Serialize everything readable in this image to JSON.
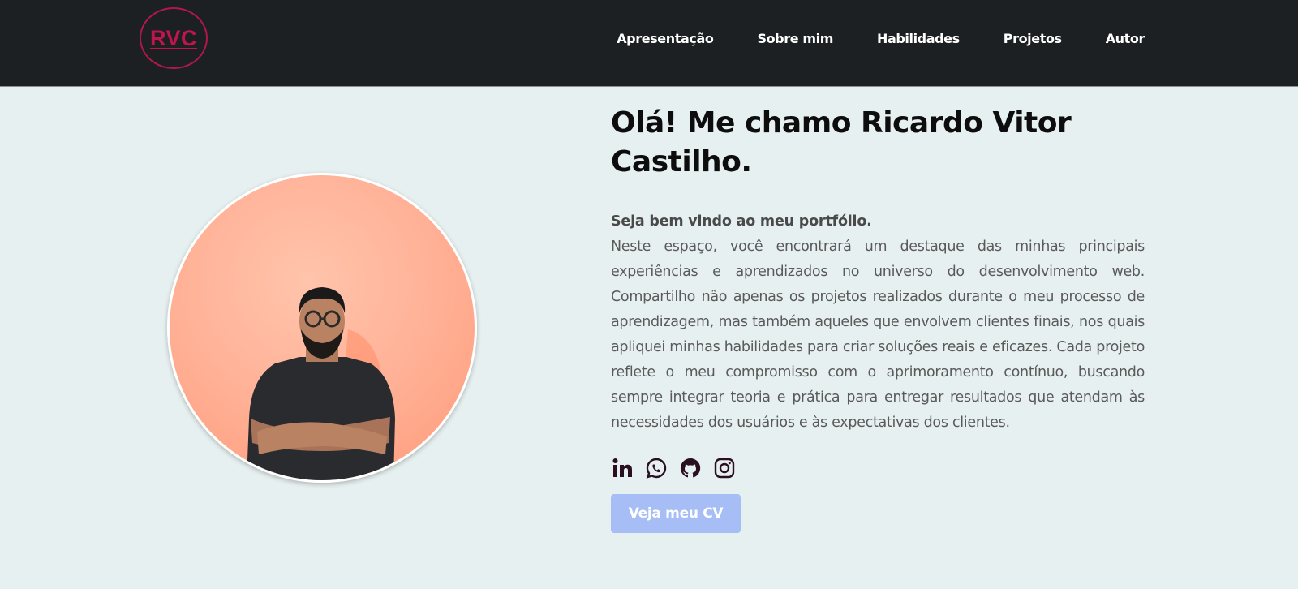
{
  "header": {
    "logo_text": "RVC",
    "nav": [
      {
        "label": "Apresentação"
      },
      {
        "label": "Sobre mim"
      },
      {
        "label": "Habilidades"
      },
      {
        "label": "Projetos"
      },
      {
        "label": "Autor"
      }
    ]
  },
  "hero": {
    "title": "Olá! Me chamo Ricardo Vitor Castilho.",
    "welcome": "Seja bem vindo ao meu portfólio.",
    "bio": "Neste espaço, você encontrará um destaque das minhas principais experiências e aprendizados no universo do desenvolvimento web. Compartilho não apenas os projetos realizados durante o meu processo de aprendizagem, mas também aqueles que envolvem clientes finais, nos quais apliquei minhas habilidades para criar soluções reais e eficazes. Cada projeto reflete o meu compromisso com o aprimoramento contínuo, buscando sempre integrar teoria e prática para entregar resultados que atendam às necessidades dos usuários e às expectativas dos clientes.",
    "socials": [
      {
        "icon": "linkedin-icon"
      },
      {
        "icon": "whatsapp-icon"
      },
      {
        "icon": "github-icon"
      },
      {
        "icon": "instagram-icon"
      }
    ],
    "cv_button": "Veja meu CV"
  },
  "colors": {
    "header_bg": "#1c2022",
    "page_bg": "#e7f0f0",
    "logo": "#c0154c",
    "cv_button": "#a6bdf6",
    "social_icon": "#2a0f20"
  }
}
